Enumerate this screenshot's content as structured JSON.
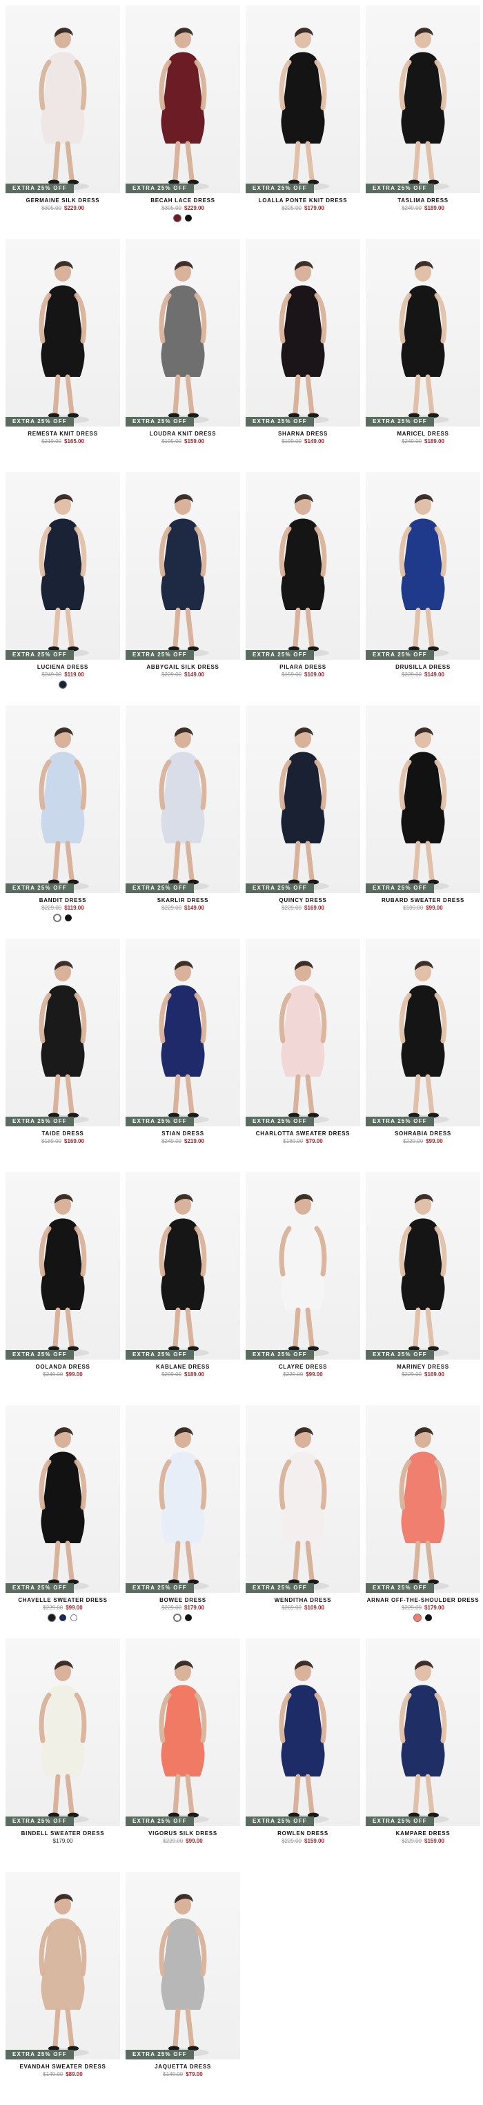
{
  "badge_text": "EXTRA 25% OFF",
  "products": [
    {
      "name": "GERMAINE SILK DRESS",
      "was": "$305.00",
      "now": "$229.00",
      "bg": "light",
      "dress": "#efe6e6",
      "skin": "#d6b59c",
      "swatches": []
    },
    {
      "name": "BECAH LACE DRESS",
      "was": "$305.00",
      "now": "$229.00",
      "bg": "light",
      "dress": "#6c1c24",
      "skin": "#d8b29a",
      "swatches": [
        "#6c1c24",
        "#111111"
      ]
    },
    {
      "name": "LOALLA PONTE KNIT DRESS",
      "was": "$225.00",
      "now": "$179.00",
      "bg": "light",
      "dress": "#141414",
      "skin": "#e0c0a8",
      "swatches": []
    },
    {
      "name": "TASLIMA DRESS",
      "was": "$249.00",
      "now": "$189.00",
      "bg": "light",
      "dress": "#151515",
      "skin": "#e0c0a8",
      "swatches": []
    },
    {
      "name": "REMESTA KNIT DRESS",
      "was": "$219.00",
      "now": "$165.00",
      "bg": "light",
      "dress": "#151515",
      "skin": "#d8b29a",
      "swatches": []
    },
    {
      "name": "LOUDRA KNIT DRESS",
      "was": "$195.00",
      "now": "$159.00",
      "bg": "light",
      "dress": "#6f6f6f",
      "skin": "#d8b29a",
      "swatches": []
    },
    {
      "name": "SHARNA DRESS",
      "was": "$199.00",
      "now": "$149.00",
      "bg": "light",
      "dress": "#1b1418",
      "skin": "#d8b29a",
      "swatches": []
    },
    {
      "name": "MARICEL DRESS",
      "was": "$249.00",
      "now": "$189.00",
      "bg": "light",
      "dress": "#151515",
      "skin": "#e0c0a8",
      "swatches": []
    },
    {
      "name": "LUCIENA DRESS",
      "was": "$249.00",
      "now": "$119.00",
      "bg": "light",
      "dress": "#1a2335",
      "skin": "#e0c0a8",
      "swatches": [
        "#1a2335"
      ]
    },
    {
      "name": "ABBYGAIL SILK DRESS",
      "was": "$229.00",
      "now": "$149.00",
      "bg": "light",
      "dress": "#1e2a44",
      "skin": "#d8b29a",
      "swatches": []
    },
    {
      "name": "PILARA DRESS",
      "was": "$159.00",
      "now": "$109.00",
      "bg": "light",
      "dress": "#151515",
      "skin": "#d8b29a",
      "swatches": []
    },
    {
      "name": "DRUSILLA DRESS",
      "was": "$229.00",
      "now": "$149.00",
      "bg": "light",
      "dress": "#1f3a8a",
      "skin": "#e0c0a8",
      "swatches": []
    },
    {
      "name": "BANDIT DRESS",
      "was": "$229.00",
      "now": "$119.00",
      "bg": "light",
      "dress": "#c9d8ea",
      "skin": "#d8b29a",
      "swatches": [
        "#ffffff",
        "#111111"
      ]
    },
    {
      "name": "SKARLIR DRESS",
      "was": "$229.00",
      "now": "$149.00",
      "bg": "light",
      "dress": "#d9dde8",
      "skin": "#d8b29a",
      "swatches": []
    },
    {
      "name": "QUINCY DRESS",
      "was": "$229.00",
      "now": "$169.00",
      "bg": "light",
      "dress": "#1a2133",
      "skin": "#d8b29a",
      "swatches": []
    },
    {
      "name": "RUBARD SWEATER DRESS",
      "was": "$199.00",
      "now": "$99.00",
      "bg": "light",
      "dress": "#121212",
      "skin": "#e0c0a8",
      "swatches": []
    },
    {
      "name": "TAIDE DRESS",
      "was": "$189.00",
      "now": "$169.00",
      "bg": "light",
      "dress": "#1a1a1a",
      "skin": "#d8b29a",
      "swatches": []
    },
    {
      "name": "STIAN DRESS",
      "was": "$249.00",
      "now": "$219.00",
      "bg": "light",
      "dress": "#1e2a6a",
      "skin": "#d8b29a",
      "swatches": []
    },
    {
      "name": "CHARLOTTA SWEATER DRESS",
      "was": "$189.00",
      "now": "$79.00",
      "bg": "light",
      "dress": "#f1d7d5",
      "skin": "#d8b29a",
      "swatches": []
    },
    {
      "name": "SOHRABIA DRESS",
      "was": "$229.00",
      "now": "$99.00",
      "bg": "light",
      "dress": "#151515",
      "skin": "#e0c0a8",
      "swatches": []
    },
    {
      "name": "OOLANDA DRESS",
      "was": "$249.00",
      "now": "$99.00",
      "bg": "light",
      "dress": "#141414",
      "skin": "#d8b29a",
      "swatches": []
    },
    {
      "name": "KABLANE DRESS",
      "was": "$299.00",
      "now": "$189.00",
      "bg": "light",
      "dress": "#161616",
      "skin": "#d8b29a",
      "swatches": []
    },
    {
      "name": "CLAYRE DRESS",
      "was": "$229.00",
      "now": "$99.00",
      "bg": "light",
      "dress": "#f5f5f5",
      "skin": "#d8b29a",
      "swatches": []
    },
    {
      "name": "MARINEY DRESS",
      "was": "$229.00",
      "now": "$169.00",
      "bg": "light",
      "dress": "#151515",
      "skin": "#e0c0a8",
      "swatches": []
    },
    {
      "name": "CHAVELLE SWEATER DRESS",
      "was": "$229.00",
      "now": "$99.00",
      "bg": "light",
      "dress": "#121212",
      "skin": "#d8b29a",
      "swatches": [
        "#1a1a1a",
        "#1a2b55",
        "#ffffff"
      ]
    },
    {
      "name": "BOWEE DRESS",
      "was": "$229.00",
      "now": "$179.00",
      "bg": "light",
      "dress": "#e7eef7",
      "skin": "#d8b29a",
      "swatches": [
        "#ffffff",
        "#111111"
      ]
    },
    {
      "name": "WENDITHA DRESS",
      "was": "$269.00",
      "now": "$109.00",
      "bg": "light",
      "dress": "#f3efef",
      "skin": "#d8b29a",
      "swatches": []
    },
    {
      "name": "ARNAR OFF-THE-SHOULDER DRESS",
      "was": "$229.00",
      "now": "$179.00",
      "bg": "light",
      "dress": "#f07f70",
      "skin": "#d8b29a",
      "swatches": [
        "#f07f70",
        "#111111"
      ]
    },
    {
      "name": "BINDELL SWEATER DRESS",
      "was": "",
      "now": "$179.00",
      "bg": "light",
      "dress": "#f1f0e6",
      "skin": "#d8b29a",
      "swatches": []
    },
    {
      "name": "VIGORUS SILK DRESS",
      "was": "$229.00",
      "now": "$99.00",
      "bg": "light",
      "dress": "#f07a63",
      "skin": "#d8b29a",
      "swatches": []
    },
    {
      "name": "ROWLEN DRESS",
      "was": "$229.00",
      "now": "$159.00",
      "bg": "light",
      "dress": "#1d2c66",
      "skin": "#d8b29a",
      "swatches": []
    },
    {
      "name": "KAMPARE DRESS",
      "was": "$229.00",
      "now": "$159.00",
      "bg": "light",
      "dress": "#1f2f66",
      "skin": "#e0c0a8",
      "swatches": []
    },
    {
      "name": "EVANDAH SWEATER DRESS",
      "was": "$149.00",
      "now": "$89.00",
      "bg": "light",
      "dress": "#d9b8a2",
      "skin": "#d8b29a",
      "swatches": []
    },
    {
      "name": "JAQUETTA DRESS",
      "was": "$149.00",
      "now": "$79.00",
      "bg": "light",
      "dress": "#b7b7b7",
      "skin": "#d8b29a",
      "swatches": []
    }
  ]
}
